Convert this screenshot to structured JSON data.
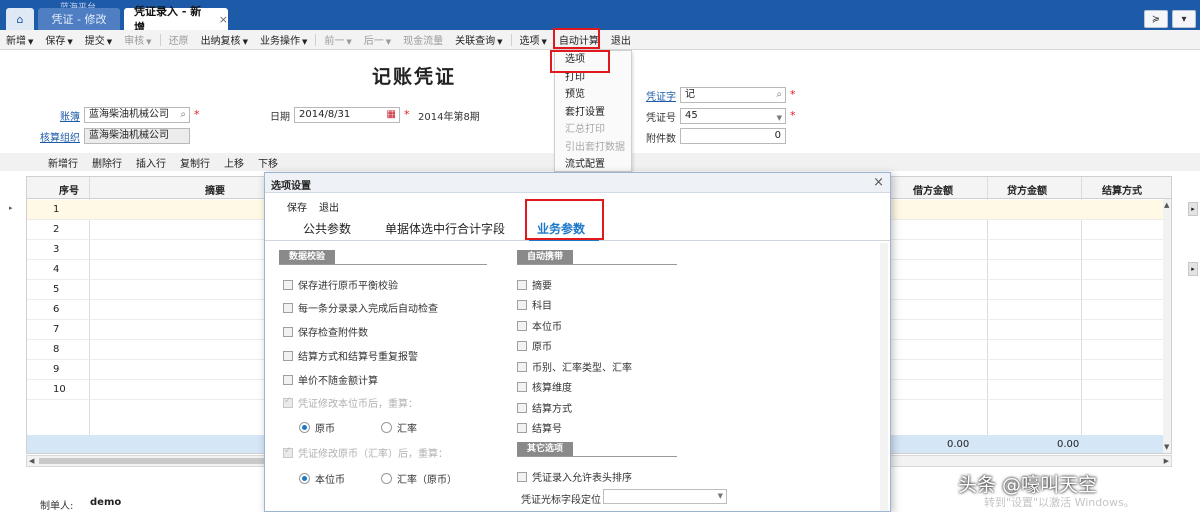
{
  "topbar": {
    "blurred_title": "蓝海平台",
    "tabs": [
      {
        "label": "⌂"
      },
      {
        "label": "凭证 - 修改"
      },
      {
        "label": "凭证录入 - 新增",
        "close": "×"
      }
    ],
    "window_buttons": [
      "≽",
      "▾"
    ]
  },
  "toolbar": {
    "items": [
      {
        "label": "新增",
        "caret": true
      },
      {
        "label": "保存",
        "caret": true
      },
      {
        "label": "提交",
        "caret": true
      },
      {
        "label": "审核",
        "caret": true,
        "disabled": true
      },
      {
        "label": "还原",
        "disabled": true
      },
      {
        "label": "出纳复核",
        "caret": true
      },
      {
        "label": "业务操作",
        "caret": true
      },
      {
        "label": "前一",
        "caret": true,
        "disabled": true
      },
      {
        "label": "后一",
        "caret": true,
        "disabled": true
      },
      {
        "label": "现金流量",
        "disabled": true
      },
      {
        "label": "关联查询",
        "caret": true
      },
      {
        "label": "选项",
        "caret": true
      },
      {
        "label": "自动计算"
      },
      {
        "label": "退出"
      }
    ]
  },
  "options_menu": {
    "items": [
      {
        "label": "选项",
        "disabled": false
      },
      {
        "label": "打印",
        "disabled": false
      },
      {
        "label": "预览",
        "disabled": false
      },
      {
        "label": "套打设置",
        "disabled": false
      },
      {
        "label": "汇总打印",
        "disabled": true
      },
      {
        "label": "引出套打数据",
        "disabled": true
      },
      {
        "label": "流式配置",
        "disabled": false
      }
    ]
  },
  "voucher": {
    "title": "记账凭证",
    "account_book_label": "账簿",
    "account_book_value": "蓝海柴油机械公司",
    "accounting_org_label": "核算组织",
    "accounting_org_value": "蓝海柴油机械公司",
    "date_label": "日期",
    "date_value": "2014/8/31",
    "period_text": "2014年第8期",
    "voucher_word_label": "凭证字",
    "voucher_word_value": "记",
    "voucher_no_label": "凭证号",
    "voucher_no_value": "45",
    "attachments_label": "附件数",
    "attachments_value": "0",
    "required_mark": "*"
  },
  "row_toolbar": [
    "新增行",
    "删除行",
    "插入行",
    "复制行",
    "上移",
    "下移"
  ],
  "grid": {
    "columns": [
      "序号",
      "摘要",
      "借方金额",
      "贷方金额",
      "结算方式"
    ],
    "rows": [
      "1",
      "2",
      "3",
      "4",
      "5",
      "6",
      "7",
      "8",
      "9",
      "10"
    ],
    "selected_row_marker": "▸",
    "total_debit": "0.00",
    "total_credit": "0.00"
  },
  "modal": {
    "title": "选项设置",
    "close": "×",
    "tools": [
      "保存",
      "退出"
    ],
    "tabs": [
      "公共参数",
      "单据体选中行合计字段",
      "业务参数"
    ],
    "active_tab": "业务参数",
    "data_check": {
      "title": "数据校验",
      "items": [
        {
          "label": "保存进行原币平衡校验",
          "checked": false,
          "disabled": false
        },
        {
          "label": "每一条分录录入完成后自动检查",
          "checked": false,
          "disabled": false
        },
        {
          "label": "保存检查附件数",
          "checked": false,
          "disabled": false
        },
        {
          "label": "结算方式和结算号重复报警",
          "checked": false,
          "disabled": false
        },
        {
          "label": "单价不随金额计算",
          "checked": false,
          "disabled": false
        },
        {
          "label": "凭证修改本位币后，重算：",
          "checked": true,
          "disabled": true
        },
        {
          "label": "凭证修改原币（汇率）后，重算：",
          "checked": true,
          "disabled": true
        }
      ],
      "radio_group1": [
        {
          "label": "原币",
          "on": true
        },
        {
          "label": "汇率",
          "on": false
        }
      ],
      "radio_group2": [
        {
          "label": "本位币",
          "on": true
        },
        {
          "label": "汇率（原币）",
          "on": false
        }
      ]
    },
    "auto_carry": {
      "title": "自动携带",
      "items": [
        "摘要",
        "科目",
        "本位币",
        "原币",
        "币别、汇率类型、汇率",
        "核算维度",
        "结算方式",
        "结算号"
      ]
    },
    "other": {
      "title": "其它选项",
      "item": "凭证录入允许表头排序",
      "cursor_label": "凭证光标字段定位"
    }
  },
  "footer": {
    "maker_label": "制单人:",
    "maker_value": "demo"
  },
  "watermark": {
    "line1": "头条 @嚎叫天空",
    "line2": "转到\"设置\"以激活 Windows。"
  },
  "colors": {
    "topbar": "#1d5aa8",
    "highlight_red": "#e0191f",
    "active_tab_blue": "#1d78c8",
    "total_row": "#d5e6f7"
  }
}
